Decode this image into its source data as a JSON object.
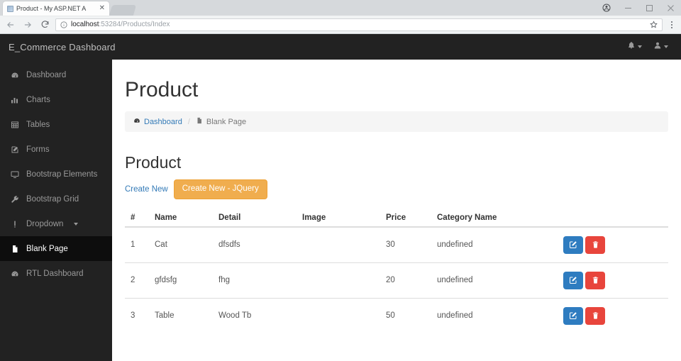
{
  "browser": {
    "tab": {
      "title": "Product - My ASP.NET A",
      "favicon_icon": "page-favicon",
      "close_icon": "close-icon"
    },
    "window_controls": {
      "profile_icon": "profile-avatar-icon",
      "minimize": "minimize-icon",
      "maximize": "maximize-icon",
      "close": "close-icon"
    },
    "toolbar": {
      "back_icon": "back-arrow-icon",
      "forward_icon": "forward-arrow-icon",
      "reload_icon": "reload-icon",
      "info_icon": "info-circle-icon",
      "url_host": "localhost",
      "url_path": ":53284/Products/Index",
      "bookmark_icon": "star-icon",
      "menu_icon": "three-dot-menu-icon"
    }
  },
  "navbar": {
    "brand": "E_Commerce Dashboard",
    "alerts_icon": "bell-icon",
    "user_icon": "user-icon"
  },
  "sidebar": {
    "items": [
      {
        "label": "Dashboard",
        "icon": "tachometer-icon",
        "active": false,
        "caret": false
      },
      {
        "label": "Charts",
        "icon": "bar-chart-icon",
        "active": false,
        "caret": false
      },
      {
        "label": "Tables",
        "icon": "table-icon",
        "active": false,
        "caret": false
      },
      {
        "label": "Forms",
        "icon": "edit-form-icon",
        "active": false,
        "caret": false
      },
      {
        "label": "Bootstrap Elements",
        "icon": "desktop-icon",
        "active": false,
        "caret": false
      },
      {
        "label": "Bootstrap Grid",
        "icon": "wrench-icon",
        "active": false,
        "caret": false
      },
      {
        "label": "Dropdown",
        "icon": "list-icon",
        "active": false,
        "caret": true
      },
      {
        "label": "Blank Page",
        "icon": "file-icon",
        "active": true,
        "caret": false
      },
      {
        "label": "RTL Dashboard",
        "icon": "tachometer-icon",
        "active": false,
        "caret": false
      }
    ]
  },
  "main": {
    "page_title": "Product",
    "breadcrumb": {
      "home_label": "Dashboard",
      "home_icon": "tachometer-icon",
      "separator": "/",
      "current_label": "Blank Page",
      "current_icon": "file-icon"
    },
    "section_title": "Product",
    "actions": {
      "create_new_link": "Create New",
      "create_new_jquery_button": "Create New - JQuery"
    },
    "table": {
      "columns": [
        "#",
        "Name",
        "Detail",
        "Image",
        "Price",
        "Category Name",
        ""
      ],
      "rows": [
        {
          "num": "1",
          "name": "Cat",
          "detail": "dfsdfs",
          "image": "",
          "price": "30",
          "category": "undefined"
        },
        {
          "num": "2",
          "name": "gfdsfg",
          "detail": "fhg",
          "image": "",
          "price": "20",
          "category": "undefined"
        },
        {
          "num": "3",
          "name": "Table",
          "detail": "Wood Tb",
          "image": "",
          "price": "50",
          "category": "undefined"
        }
      ],
      "row_actions": {
        "edit_icon": "pencil-square-icon",
        "delete_icon": "trash-icon"
      }
    }
  },
  "colors": {
    "navbar_bg": "#222222",
    "sidebar_active_bg": "#0d0d0d",
    "link_blue": "#337ab7",
    "warning_orange": "#f0ad4e",
    "edit_blue": "#2e7cc0",
    "delete_red": "#e8453c"
  }
}
